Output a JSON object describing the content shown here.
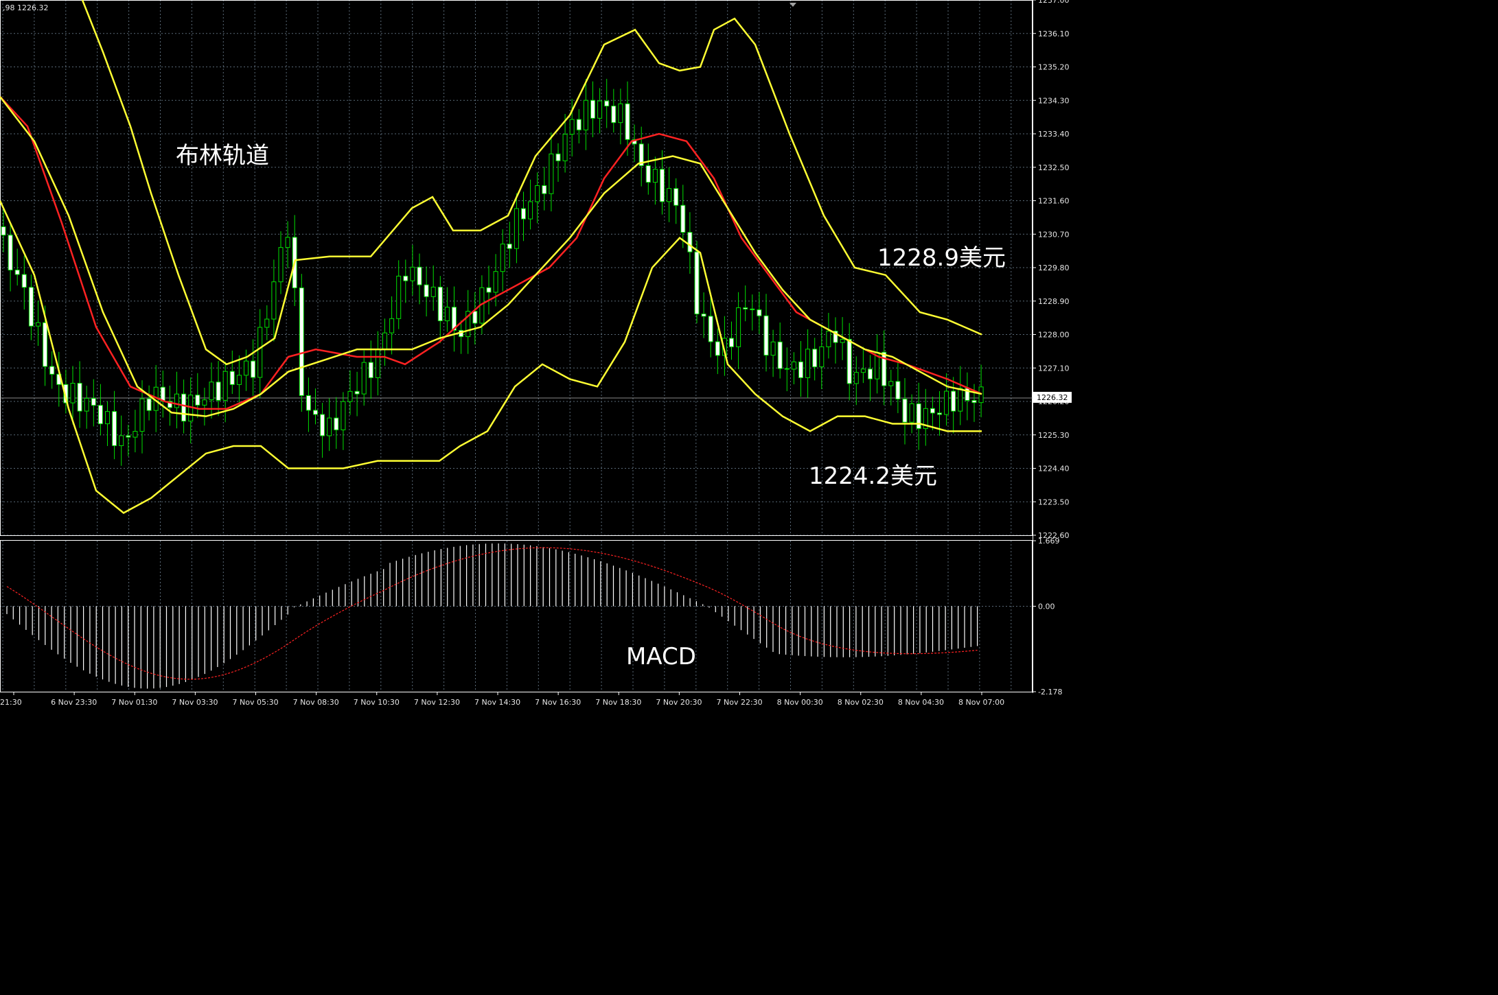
{
  "header": {
    "ohlc_text": ",98 1226.32"
  },
  "colors": {
    "background": "#000000",
    "grid": "#5a6a78",
    "frame": "#ffffff",
    "bull": "#00e000",
    "bear_body": "#ffffff",
    "bb": "#ffff33",
    "ma": "#ff2222",
    "macd_hist": "#ffffff",
    "signal": "#ff2222",
    "current_price_line": "#a9a9a9"
  },
  "annotations": {
    "bollinger": "布林轨道",
    "upper_price": "1228.9美元",
    "lower_price": "1224.2美元",
    "macd": "MACD"
  },
  "current_price_label": "1226.32",
  "chart_data": [
    {
      "type": "candlestick",
      "title": "",
      "ylim": [
        1222.6,
        1237.0
      ],
      "y_ticks": [
        "1237.00",
        "1236.10",
        "1235.20",
        "1234.30",
        "1233.40",
        "1232.50",
        "1231.60",
        "1230.70",
        "1229.80",
        "1228.90",
        "1228.00",
        "1227.10",
        "1226.20",
        "1225.30",
        "1224.40",
        "1223.50",
        "1222.60"
      ],
      "x_ticks": [
        "21:30",
        "6 Nov 23:30",
        "7 Nov 01:30",
        "7 Nov 03:30",
        "7 Nov 05:30",
        "7 Nov 08:30",
        "7 Nov 10:30",
        "7 Nov 12:30",
        "7 Nov 14:30",
        "7 Nov 16:30",
        "7 Nov 18:30",
        "7 Nov 20:30",
        "7 Nov 22:30",
        "8 Nov 00:30",
        "8 Nov 02:30",
        "8 Nov 04:30",
        "8 Nov 07:00"
      ],
      "current_price": 1226.32,
      "series": [
        {
          "kind": "ohlc",
          "key": [
            0.4,
            1.0,
            1.4,
            2.2,
            3.0,
            3.6,
            4.4,
            4.8,
            5.4,
            6.6,
            7.2,
            8.4,
            9.4,
            10.1,
            10.6,
            11.6,
            13.4,
            14.7,
            15.0,
            15.6,
            16.6,
            17.6,
            18.5,
            19.6,
            20.6,
            21.3,
            22.5,
            23.6,
            24.6,
            25.5,
            26.7,
            27.3,
            28.3,
            29.6,
            30.6,
            31.5,
            32.5,
            33.4,
            34.2,
            35.0,
            36.0,
            36.9,
            37.5,
            38.5,
            39.8,
            40.6,
            41.7,
            42.8,
            43.6,
            44.6,
            45.6,
            46.6,
            47.3,
            48.3,
            49.2,
            50.6,
            51.6,
            52.6,
            53.6,
            54.6,
            55.6,
            56.6,
            57.4,
            58.3,
            59.2,
            60.5,
            61.6,
            62.6,
            63.6,
            64.4,
            65.5,
            66.6,
            67.5,
            68.6,
            69.6,
            70.6,
            71.6,
            72.6,
            73.4,
            74.4,
            75.6,
            76.6,
            77.5,
            78.6,
            79.6,
            80.6,
            81.6,
            82.3,
            83.3,
            84.3,
            85.3,
            86.5,
            87.6,
            88.6,
            89.6,
            90.6,
            91.5,
            92.6,
            93.6,
            94.6,
            95.6,
            96.6,
            97.6,
            98.6,
            99.4,
            100.3,
            101.6,
            102.6,
            103.6,
            104.5,
            105.5,
            106.6,
            107.6,
            108.6,
            109.6,
            110.6,
            111.6,
            112.6,
            113.6,
            114.6,
            115.6,
            116.6,
            117.6,
            118.6,
            119.6,
            120.6,
            121.6,
            122.6,
            123.6,
            124.6,
            125.6,
            126.6,
            127.6,
            128.6,
            129.6,
            130.6,
            131.6,
            132.6,
            133.6,
            134.6,
            135.6,
            136.6,
            137.6,
            138.6,
            139.6,
            140.6,
            141.6,
            142.6,
            143.6,
            144.6,
            145.6,
            146.6,
            147.6,
            148.6,
            149.6,
            150.6,
            151.6,
            152.6,
            153.6,
            154.6,
            155.6,
            156.6,
            157.6,
            158.6,
            159.6,
            160.6,
            161.6,
            162.6,
            163.6,
            164.6,
            165.6,
            166.6,
            167.6,
            168.6
          ],
          "candles": [
            [
              1230.9,
              1231.4,
              1230.6,
              1230.7
            ],
            [
              1231.4,
              1231.8,
              1230.8,
              1231.0
            ],
            [
              1231.0,
              1231.3,
              1229.8,
              1230.0
            ],
            [
              1230.0,
              1230.4,
              1229.3,
              1229.4
            ],
            [
              1230.7,
              1230.9,
              1229.8,
              1230.0
            ],
            [
              1230.3,
              1230.4,
              1229.4,
              1229.6
            ],
            [
              1229.6,
              1229.9,
              1229.1,
              1229.2
            ],
            [
              1229.1,
              1229.3,
              1228.5,
              1228.6
            ],
            [
              1229.0,
              1229.1,
              1228.3,
              1228.4
            ],
            [
              1228.9,
              1229.0,
              1227.8,
              1227.9
            ],
            [
              1228.0,
              1228.2,
              1226.9,
              1227.0
            ],
            [
              1227.0,
              1227.2,
              1225.9,
              1226.0
            ]
          ]
        }
      ]
    },
    {
      "type": "bar",
      "title": "",
      "ylim": [
        -2.178,
        1.669
      ],
      "y_ticks": [
        "1.669",
        "0.00",
        "-2.178"
      ],
      "series": [
        {
          "name": "",
          "kind": "histogram",
          "values": []
        },
        {
          "name": "",
          "kind": "signal_line",
          "values": []
        }
      ]
    }
  ]
}
